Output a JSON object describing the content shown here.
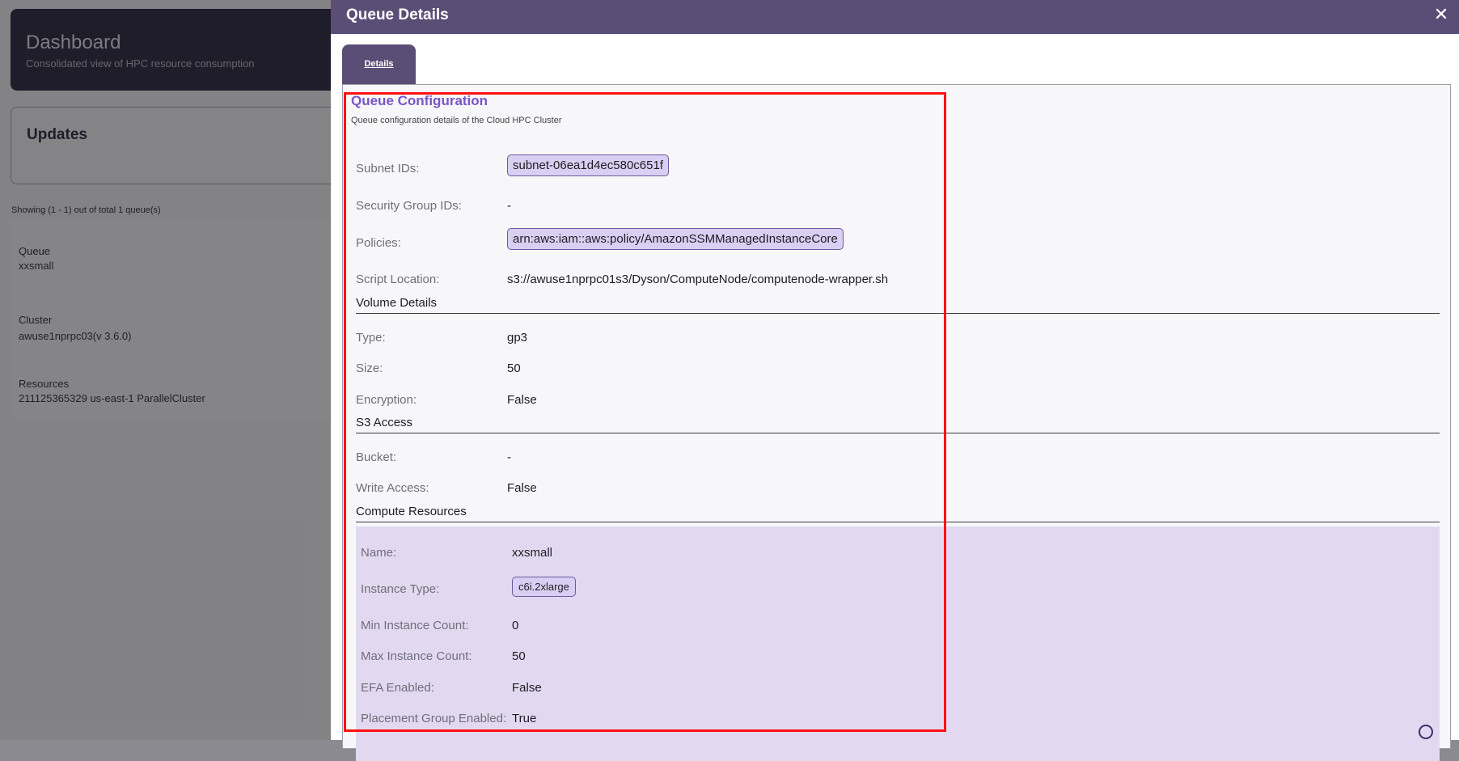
{
  "background": {
    "dashboard": {
      "title": "Dashboard",
      "subtitle": "Consolidated view of HPC resource consumption"
    },
    "updates": {
      "title": "Updates"
    },
    "showing_text": "Showing (1 - 1) out of total 1 queue(s)",
    "queue_list": {
      "queue_label": "Queue",
      "queue_value": "xxsmall",
      "cluster_label": "Cluster",
      "cluster_value": "awuse1nprpc03(v 3.6.0)",
      "resources_label": "Resources",
      "resources_value": "211125365329 us-east-1 ParallelCluster"
    }
  },
  "drawer": {
    "title": "Queue Details",
    "close_icon": "close-icon",
    "tab_label": "Details"
  },
  "queue_config": {
    "title": "Queue Configuration",
    "subtitle": "Queue configuration details of the Cloud HPC Cluster",
    "subnet_label": "Subnet IDs:",
    "subnet_value": "subnet-06ea1d4ec580c651f",
    "security_label": "Security Group IDs:",
    "security_value": "-",
    "policies_label": "Policies:",
    "policies_value": "arn:aws:iam::aws:policy/AmazonSSMManagedInstanceCore",
    "script_label": "Script Location:",
    "script_value": "s3://awuse1nprpc01s3/Dyson/ComputeNode/computenode-wrapper.sh"
  },
  "volume": {
    "heading": "Volume Details",
    "type_label": "Type:",
    "type_value": "gp3",
    "size_label": "Size:",
    "size_value": "50",
    "encryption_label": "Encryption:",
    "encryption_value": "False"
  },
  "s3": {
    "heading": "S3 Access",
    "bucket_label": "Bucket:",
    "bucket_value": "-",
    "write_label": "Write Access:",
    "write_value": "False"
  },
  "compute": {
    "heading": "Compute Resources",
    "name_label": "Name:",
    "name_value": "xxsmall",
    "instance_label": "Instance Type:",
    "instance_value": "c6i.2xlarge",
    "min_label": "Min Instance Count:",
    "min_value": "0",
    "max_label": "Max Instance Count:",
    "max_value": "50",
    "efa_label": "EFA Enabled:",
    "efa_value": "False",
    "placement_label": "Placement Group Enabled:",
    "placement_value": "True"
  },
  "colors": {
    "header_bg": "#5b4e76",
    "accent_purple": "#7a55c6",
    "chip_bg": "#d9cff2",
    "compute_bg": "#e2d9f1",
    "highlight": "#ff1010"
  }
}
